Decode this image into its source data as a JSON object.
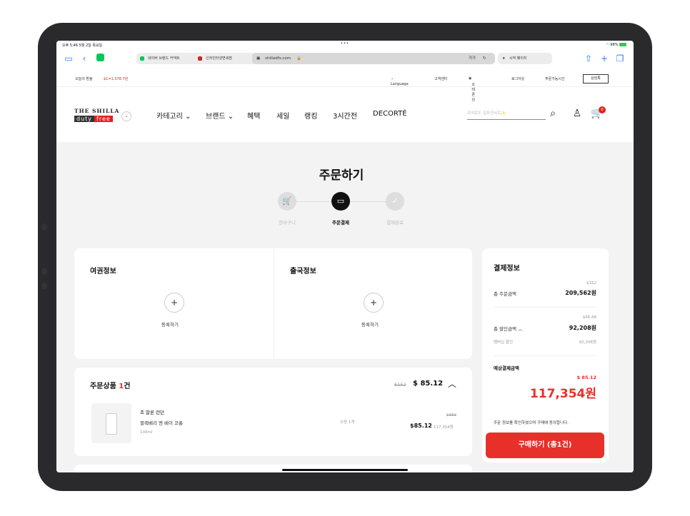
{
  "status_bar": {
    "time": "오후 5:46  5월 2일 목요일",
    "dots": "•••",
    "battery": "98%"
  },
  "browser": {
    "tabs": [
      {
        "label": "네이버 브랜드 커넥트"
      },
      {
        "label": "신라인터넷면세점"
      }
    ],
    "address": "shilladfs.com",
    "address_right": "가가",
    "start_page_tab": "시작 페이지"
  },
  "util_bar": {
    "exchange_label": "오늘의 환율",
    "exchange_value": "$1=1,378.7원",
    "language": "Language",
    "customer_center": "고객센터",
    "user_name": "오테론님",
    "logout": "로그아웃",
    "order_hours": "주문가능시간",
    "consult": "상담톡"
  },
  "header": {
    "logo_line1": "THE SHILLA",
    "logo_duty": "duty",
    "logo_free": "free",
    "nav": [
      "카테고리",
      "브랜드",
      "혜택",
      "세일",
      "랭킹",
      "3시간전",
      "DECORTÉ"
    ],
    "search_placeholder": "조여료도 설퓨전씨로✨",
    "cart_count": "0"
  },
  "page": {
    "title": "주문하기",
    "steps": [
      "장바구니",
      "주문결제",
      "결제완료"
    ],
    "active_step": 1
  },
  "passport": {
    "title": "여권정보",
    "register": "등록하기"
  },
  "departure": {
    "title": "출국정보",
    "register": "등록하기"
  },
  "order_items": {
    "title_prefix": "주문상품 ",
    "count": "1",
    "title_suffix": "건",
    "original_total": "$152",
    "discount_total": "$ 85.12",
    "item": {
      "brand": "조 말론 런던",
      "name": "블랙베리 앤 베이 코롱",
      "size": "100ml",
      "quantity": "수량 1개",
      "original_price": "$152",
      "price": "$85.12",
      "price_krw": "117,354원"
    }
  },
  "payment": {
    "title": "결제정보",
    "total_order_label": "총 주문금액",
    "total_order_usd": "$152",
    "total_order_krw": "209,562원",
    "total_discount_label": "총 할인금액",
    "total_discount_usd": "$66.88",
    "total_discount_krw": "92,208원",
    "membership_label": "멤버십 할인",
    "membership_krw": "92,208원",
    "expected_label": "예상결제금액",
    "expected_usd": "$ 85.12",
    "expected_krw": "117,354원",
    "agree_text": "주문 정보를 확인하였으며 구매에 동의합니다.",
    "buy_button": "구매하기 (총1건)"
  },
  "colors": {
    "brand_red": "#e8302b",
    "dark": "#111111",
    "bg": "#f3f3f3"
  }
}
